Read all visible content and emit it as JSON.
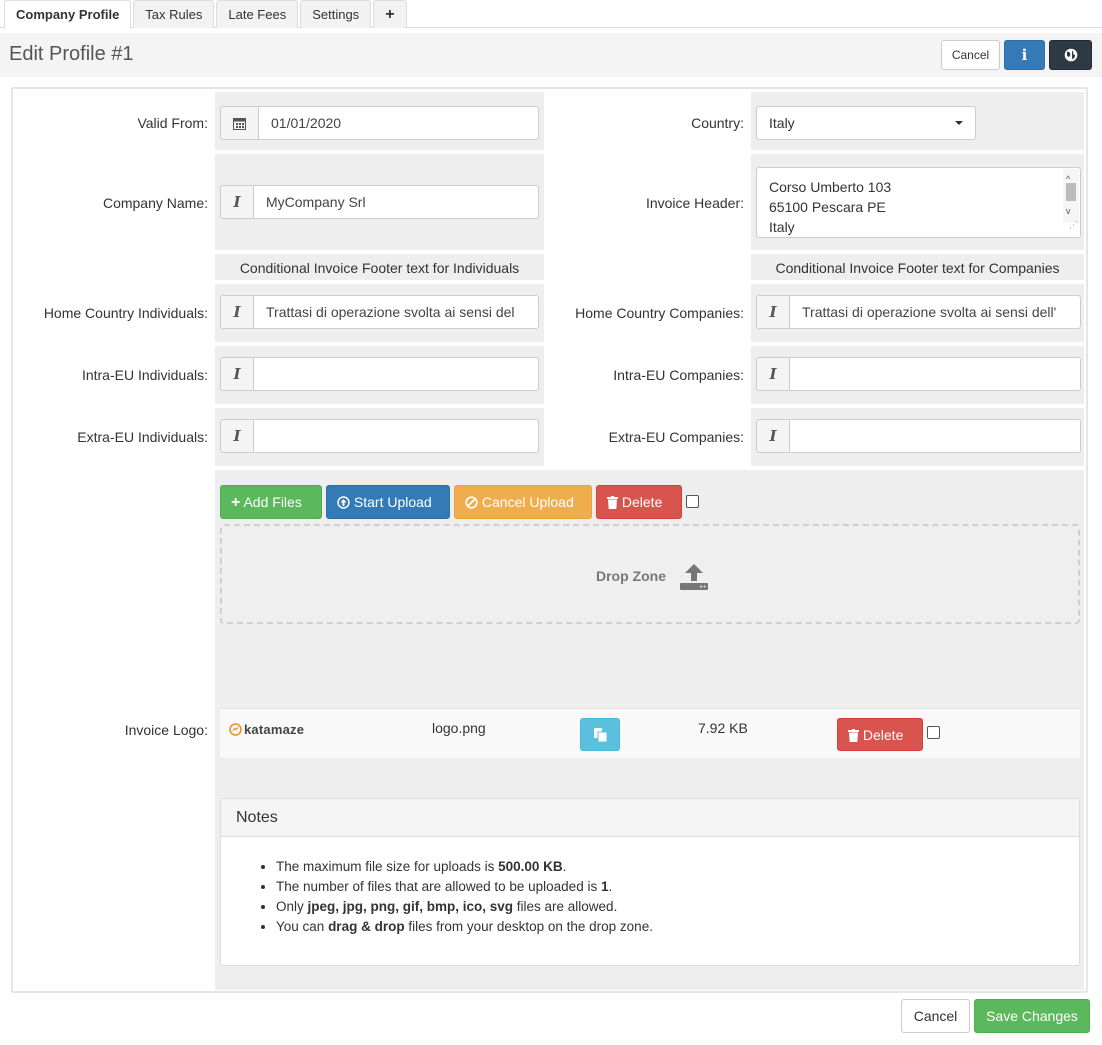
{
  "tabs": [
    {
      "label": "Company Profile"
    },
    {
      "label": "Tax Rules"
    },
    {
      "label": "Late Fees"
    },
    {
      "label": "Settings"
    },
    {
      "label": "+"
    }
  ],
  "header": {
    "title": "Edit Profile #1",
    "cancel_label": "Cancel",
    "info_icon": "i",
    "globe_icon": "globe-icon"
  },
  "form": {
    "valid_from_label": "Valid From:",
    "valid_from_value": "01/01/2020",
    "country_label": "Country:",
    "country_value": "Italy",
    "company_name_label": "Company Name:",
    "company_name_value": "MyCompany Srl",
    "invoice_header_label": "Invoice Header:",
    "invoice_header_lines": [
      "Corso Umberto 103",
      "65100 Pescara PE",
      "Italy"
    ],
    "footer_individuals_heading": "Conditional Invoice Footer text for Individuals",
    "footer_companies_heading": "Conditional Invoice Footer text for Companies",
    "home_individuals_label": "Home Country Individuals:",
    "home_individuals_value": "Trattasi di operazione svolta ai sensi del",
    "home_companies_label": "Home Country Companies:",
    "home_companies_value": "Trattasi di operazione svolta ai sensi dell'",
    "intra_individuals_label": "Intra-EU Individuals:",
    "intra_companies_label": "Intra-EU Companies:",
    "extra_individuals_label": "Extra-EU Individuals:",
    "extra_companies_label": "Extra-EU Companies:",
    "invoice_logo_label": "Invoice Logo:"
  },
  "upload": {
    "add_files": "Add Files",
    "start_upload": "Start Upload",
    "cancel_upload": "Cancel Upload",
    "delete": "Delete",
    "drop_zone": "Drop Zone",
    "file": {
      "logo_text": "katamaze",
      "name": "logo.png",
      "size": "7.92 KB",
      "delete": "Delete"
    }
  },
  "notes": {
    "title": "Notes",
    "items": [
      {
        "pre": "The maximum file size for uploads is ",
        "bold": "500.00 KB",
        "post": "."
      },
      {
        "pre": "The number of files that are allowed to be uploaded is ",
        "bold": "1",
        "post": "."
      },
      {
        "pre": "Only ",
        "bold": "jpeg, jpg, png, gif, bmp, ico, svg",
        "post": " files are allowed."
      },
      {
        "pre": "You can ",
        "bold": "drag & drop",
        "post": " files from your desktop on the drop zone."
      }
    ]
  },
  "footer": {
    "cancel_label": "Cancel",
    "save_label": "Save Changes"
  },
  "colors": {
    "primary": "#337ab7",
    "success": "#5cb85c",
    "warning": "#f0ad4e",
    "danger": "#d9534f",
    "info": "#5bc0de"
  }
}
